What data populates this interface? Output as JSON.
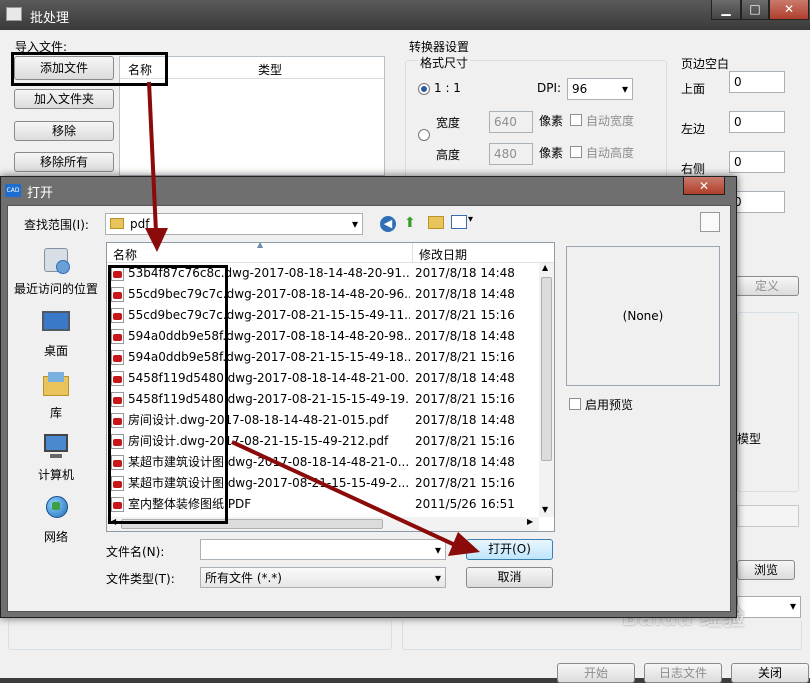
{
  "bg": {
    "title": "批处理",
    "import_label": "导入文件:",
    "btn_add_file": "添加文件",
    "btn_add_folder": "加入文件夹",
    "btn_remove": "移除",
    "btn_remove_all": "移除所有",
    "col_name": "名称",
    "col_type": "类型",
    "converter_label": "转换器设置",
    "format_label": "格式尺寸",
    "ratio_label": "1 : 1",
    "dpi_label": "DPI:",
    "dpi_value": "96",
    "width_label": "宽度",
    "width_value": "640",
    "height_label": "高度",
    "height_value": "480",
    "pixel_label": "像素",
    "auto_width": "自动宽度",
    "auto_height": "自动高度",
    "margin_label": "页边空白",
    "margin_top": "上面",
    "margin_left": "左边",
    "margin_right": "右侧",
    "margin_top_value": "0",
    "margin_left_value": "0",
    "margin_right_value": "0",
    "margin_bottom_value": "0",
    "custom_label": "定义",
    "model_label": "模型",
    "browse_label": "浏览",
    "btn_start": "开始",
    "btn_log": "日志文件",
    "btn_close": "关闭"
  },
  "dialog": {
    "app_icon": "CAD",
    "title": "打开",
    "lookin_label": "查找范围(I):",
    "folder_name": "pdf",
    "preview_text": "(None)",
    "enable_preview": "启用预览",
    "col_name": "名称",
    "col_date": "修改日期",
    "places": [
      {
        "label": "最近访问的位置",
        "icon": "recent-places-icon"
      },
      {
        "label": "桌面",
        "icon": "desktop-icon"
      },
      {
        "label": "库",
        "icon": "libraries-icon"
      },
      {
        "label": "计算机",
        "icon": "computer-icon"
      },
      {
        "label": "网络",
        "icon": "network-icon"
      }
    ],
    "files": [
      {
        "name": "53b4f87c76c8c.dwg-2017-08-18-14-48-20-91...",
        "date": "2017/8/18 14:48"
      },
      {
        "name": "55cd9bec79c7c.dwg-2017-08-18-14-48-20-96...",
        "date": "2017/8/18 14:48"
      },
      {
        "name": "55cd9bec79c7c.dwg-2017-08-21-15-15-49-11...",
        "date": "2017/8/21 15:16"
      },
      {
        "name": "594a0ddb9e58f.dwg-2017-08-18-14-48-20-98...",
        "date": "2017/8/18 14:48"
      },
      {
        "name": "594a0ddb9e58f.dwg-2017-08-21-15-15-49-18...",
        "date": "2017/8/21 15:16"
      },
      {
        "name": "5458f119d5480.dwg-2017-08-18-14-48-21-00...",
        "date": "2017/8/18 14:48"
      },
      {
        "name": "5458f119d5480.dwg-2017-08-21-15-15-49-19...",
        "date": "2017/8/21 15:16"
      },
      {
        "name": "房间设计.dwg-2017-08-18-14-48-21-015.pdf",
        "date": "2017/8/18 14:48"
      },
      {
        "name": "房间设计.dwg-2017-08-21-15-15-49-212.pdf",
        "date": "2017/8/21 15:16"
      },
      {
        "name": "某超市建筑设计图.dwg-2017-08-18-14-48-21-0...",
        "date": "2017/8/18 14:48"
      },
      {
        "name": "某超市建筑设计图.dwg-2017-08-21-15-15-49-2...",
        "date": "2017/8/21 15:16"
      },
      {
        "name": "室内整体装修图纸.PDF",
        "date": "2011/5/26 16:51"
      }
    ],
    "filename_label": "文件名(N):",
    "filename_value": "",
    "filetype_label": "文件类型(T):",
    "filetype_value": "所有文件 (*.*)",
    "btn_open": "打开(O)",
    "btn_cancel": "取消"
  },
  "watermark": "Baidu 经验",
  "colors": {
    "annotation_arrow": "#8b0a0a",
    "highlight_box": "#000000",
    "pdf_icon": "#c8171b"
  }
}
